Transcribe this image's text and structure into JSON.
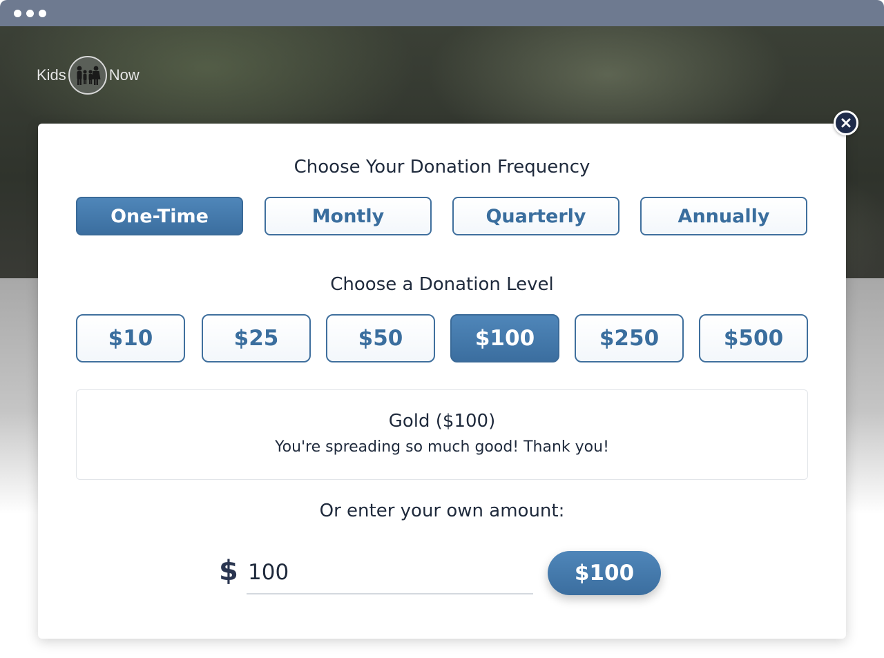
{
  "browser": {
    "dots": [
      "dot",
      "dot",
      "dot"
    ]
  },
  "logo": {
    "left_text": "Kids",
    "right_text": "Now"
  },
  "modal": {
    "frequency_title": "Choose Your Donation Frequency",
    "frequencies": [
      {
        "label": "One-Time",
        "selected": true
      },
      {
        "label": "Montly",
        "selected": false
      },
      {
        "label": "Quarterly",
        "selected": false
      },
      {
        "label": "Annually",
        "selected": false
      }
    ],
    "level_title": "Choose a Donation Level",
    "levels": [
      {
        "label": "$10",
        "selected": false
      },
      {
        "label": "$25",
        "selected": false
      },
      {
        "label": "$50",
        "selected": false
      },
      {
        "label": "$100",
        "selected": true
      },
      {
        "label": "$250",
        "selected": false
      },
      {
        "label": "$500",
        "selected": false
      }
    ],
    "level_info": {
      "name": "Gold ($100)",
      "message": "You're spreading so much good! Thank you!"
    },
    "custom_title": "Or enter your own amount:",
    "currency_symbol": "$",
    "amount_value": "100",
    "submit_label": "$100"
  },
  "icons": {
    "close": "close-icon",
    "logo": "family-icon"
  },
  "colors": {
    "accent": "#3b6e9f",
    "dark": "#1f2a3c",
    "browser_bar": "#6e7a90"
  }
}
